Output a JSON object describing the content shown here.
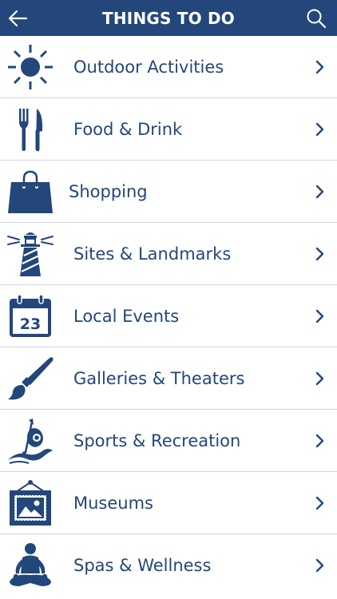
{
  "header": {
    "title": "THINGS TO DO",
    "back_icon": "back-arrow-icon",
    "search_icon": "search-icon"
  },
  "colors": {
    "primary": "#23477a",
    "divider": "#cfd6df",
    "background": "#ffffff"
  },
  "categories": [
    {
      "label": "Outdoor Activities",
      "icon": "sun-icon"
    },
    {
      "label": "Food & Drink",
      "icon": "fork-knife-icon"
    },
    {
      "label": "Shopping",
      "icon": "shopping-bag-icon"
    },
    {
      "label": "Sites & Landmarks",
      "icon": "lighthouse-icon"
    },
    {
      "label": "Local Events",
      "icon": "calendar-icon",
      "icon_text": "23"
    },
    {
      "label": "Galleries & Theaters",
      "icon": "paintbrush-icon"
    },
    {
      "label": "Sports & Recreation",
      "icon": "kayak-icon"
    },
    {
      "label": "Museums",
      "icon": "framed-picture-icon"
    },
    {
      "label": "Spas & Wellness",
      "icon": "meditation-icon"
    }
  ]
}
